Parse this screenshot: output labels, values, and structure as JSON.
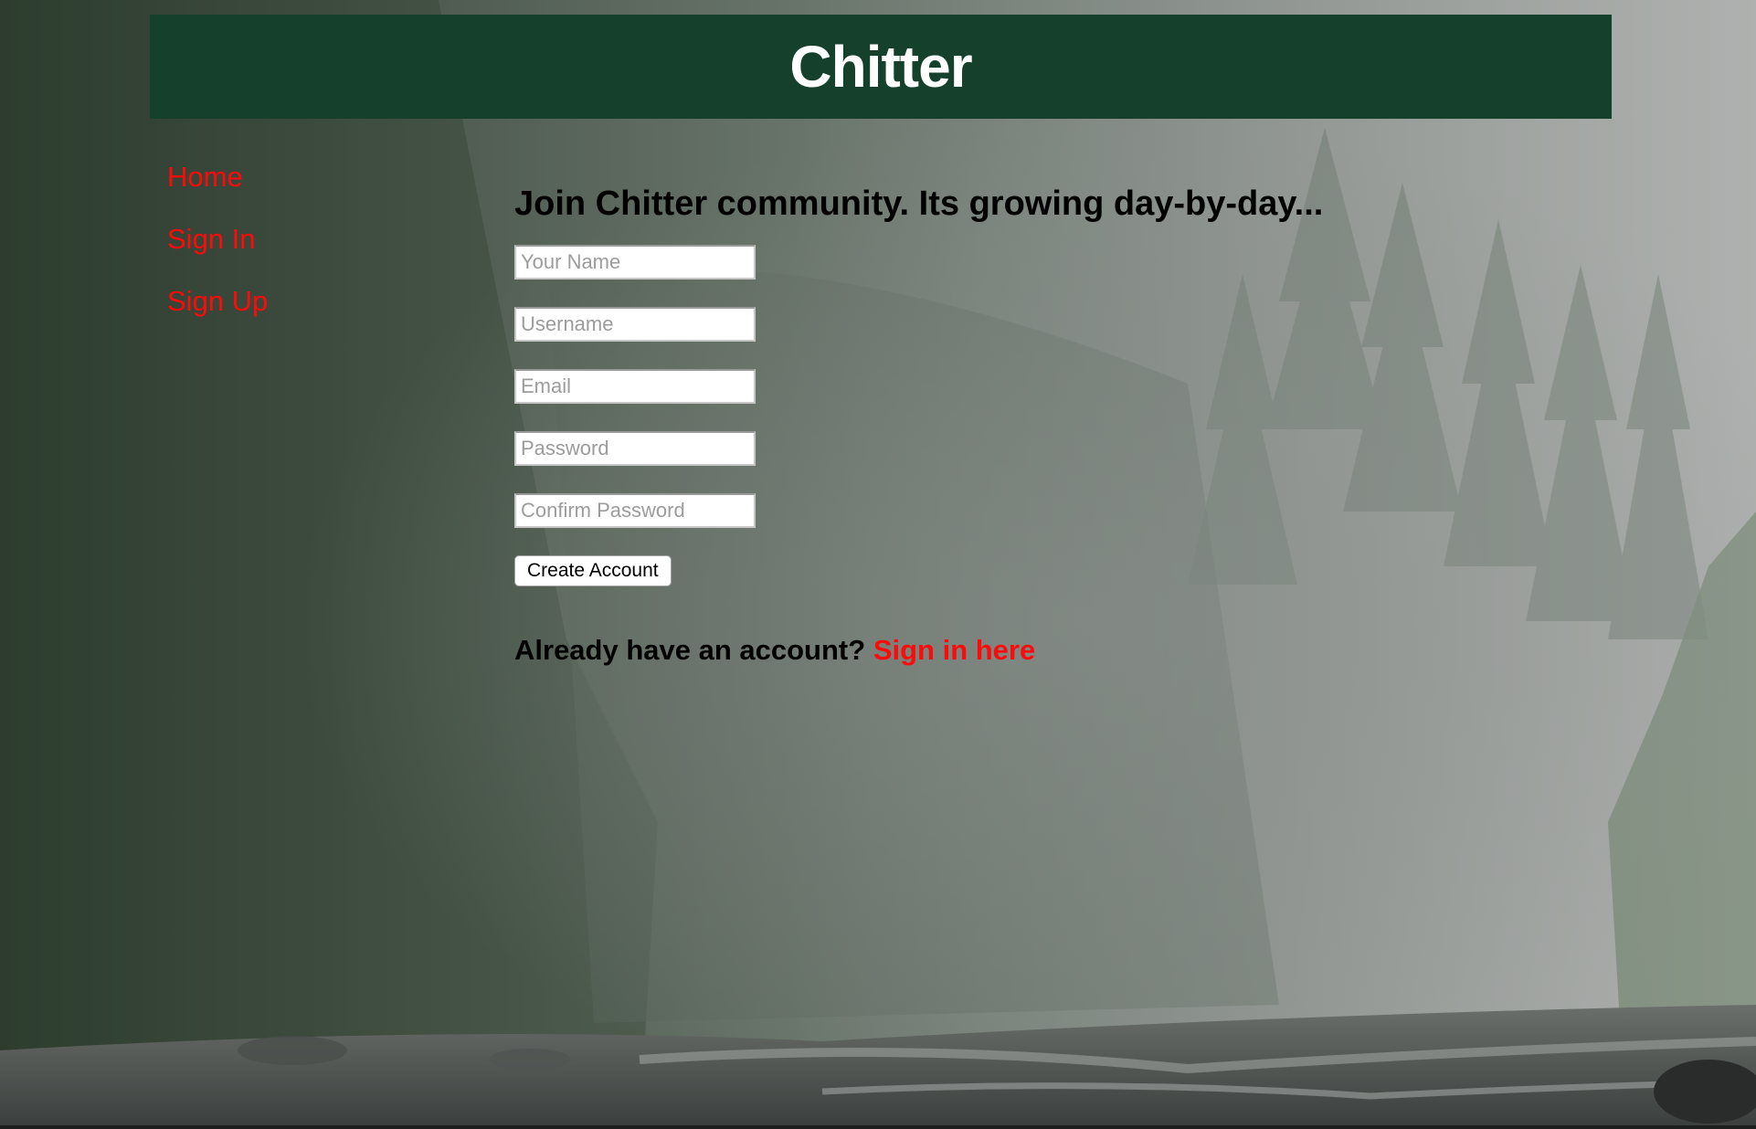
{
  "header": {
    "title": "Chitter"
  },
  "nav": {
    "items": [
      {
        "label": "Home"
      },
      {
        "label": "Sign In"
      },
      {
        "label": "Sign Up"
      }
    ]
  },
  "signup": {
    "heading": "Join Chitter community. Its growing day-by-day...",
    "fields": {
      "name_placeholder": "Your Name",
      "username_placeholder": "Username",
      "email_placeholder": "Email",
      "password_placeholder": "Password",
      "confirm_password_placeholder": "Confirm Password"
    },
    "submit_label": "Create Account",
    "already_text": "Already have an account?",
    "signin_link_label": "Sign in here"
  },
  "colors": {
    "header_bg": "#15402b",
    "header_text": "#ffffff",
    "link": "#ff0a0a",
    "text": "#000000"
  }
}
